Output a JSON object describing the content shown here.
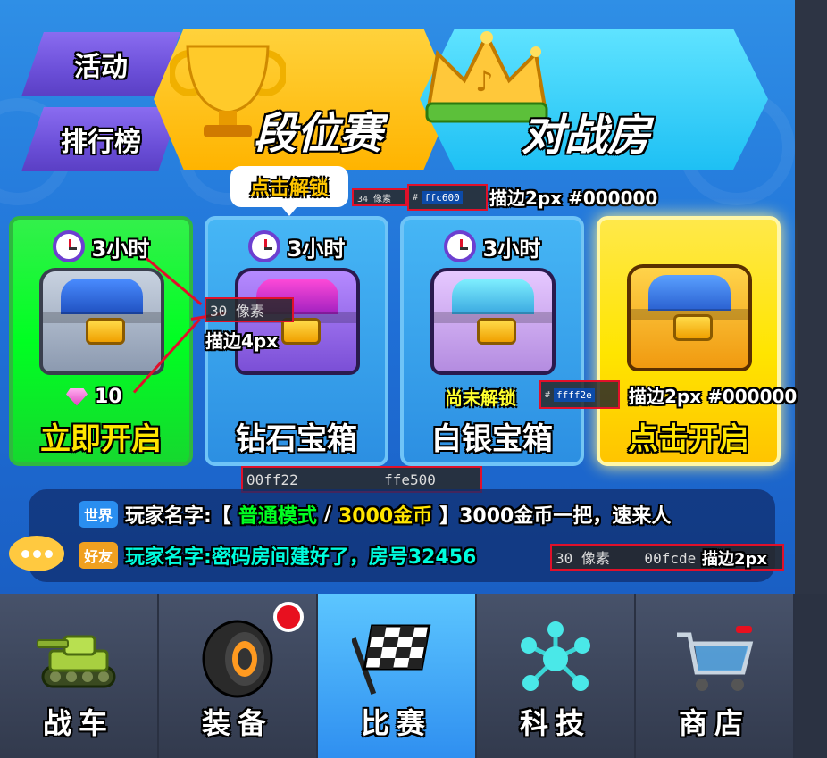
{
  "side_buttons": {
    "activity": "活动",
    "leaderboard": "排行榜"
  },
  "banners": {
    "rank": "段位赛",
    "battle_room": "对战房"
  },
  "tooltip": {
    "text": "点击解锁"
  },
  "annotations": {
    "tip_size": "34 像素",
    "tip_hash": "#",
    "tip_color": "ffc600",
    "tip_stroke": "描边2px #000000",
    "chest_size": "30 像素",
    "chest_stroke": "描边4px",
    "locked_hash": "#",
    "locked_color": "ffff2e",
    "locked_stroke": "描边2px #000000",
    "card_colors": "00ff22          ffe500",
    "chat_size": "30 像素    00fcde",
    "chat_stroke": "描边2px"
  },
  "chests": [
    {
      "timer": "3小时",
      "gem_count": "10",
      "title": "立即开启",
      "style": "green"
    },
    {
      "timer": "3小时",
      "title": "钻石宝箱",
      "style": "blue"
    },
    {
      "timer": "3小时",
      "title": "白银宝箱",
      "style": "blue"
    },
    {
      "title": "点击开启",
      "style": "gold"
    }
  ],
  "locked_label": "尚未解锁",
  "chat": {
    "world_badge": "世界",
    "world_prefix": "玩家名字:【",
    "world_mode": "普通模式",
    "world_sep": "/",
    "world_gold": "3000金币",
    "world_suffix": "】3000金币一把，速来人",
    "friend_badge": "好友",
    "friend_text": "玩家名字:密码房间建好了，房号32456"
  },
  "nav": [
    {
      "label": "战车",
      "icon": "tank-icon"
    },
    {
      "label": "装备",
      "icon": "tire-icon",
      "has_notification": true
    },
    {
      "label": "比赛",
      "icon": "checkered-flag-icon",
      "active": true
    },
    {
      "label": "科技",
      "icon": "tech-nodes-icon"
    },
    {
      "label": "商店",
      "icon": "shopping-cart-icon"
    }
  ],
  "colors": {
    "tooltip_text": "#ffc600",
    "green_card": "#00ff22",
    "gold_text": "#ffe500",
    "locked_text": "#ffff2e",
    "chat_cyan": "#00fcde",
    "stroke": "#000000"
  }
}
